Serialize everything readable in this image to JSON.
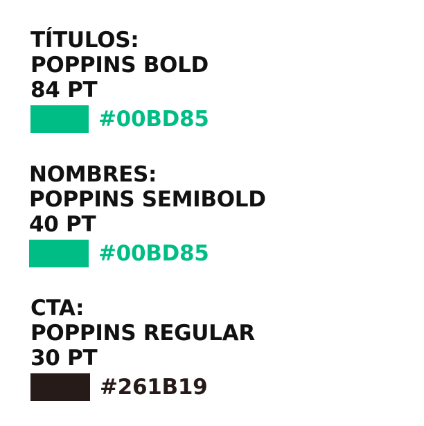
{
  "blocks": [
    {
      "heading": "TÍTULOS:",
      "font": "POPPINS BOLD",
      "size": "84 PT",
      "color_label": "#00BD85",
      "swatch_color": "#00BD85",
      "text_color": "#00BD85"
    },
    {
      "heading": "NOMBRES:",
      "font": "POPPINS SEMIBOLD",
      "size": "40 PT",
      "color_label": "#00BD85",
      "swatch_color": "#00BD85",
      "text_color": "#00BD85"
    },
    {
      "heading": "CTA:",
      "font": "POPPINS REGULAR",
      "size": "30 PT",
      "color_label": "#261B19",
      "swatch_color": "#261B19",
      "text_color": "#261B19"
    }
  ]
}
